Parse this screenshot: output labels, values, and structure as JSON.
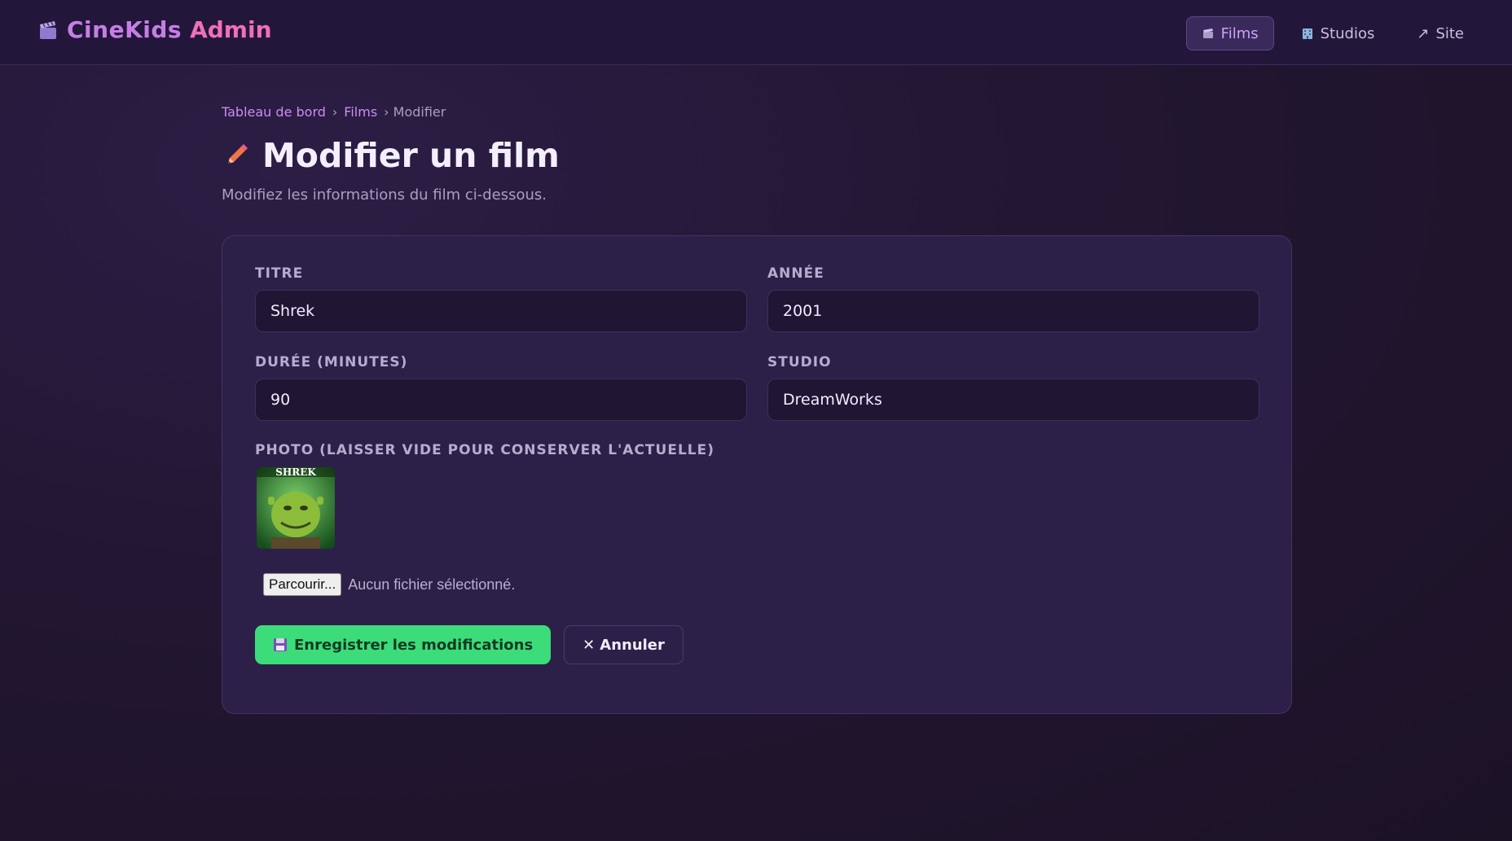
{
  "brand": {
    "name": "CineKids",
    "admin": "Admin"
  },
  "nav": [
    {
      "label": "Films",
      "icon": "film-icon",
      "active": true
    },
    {
      "label": "Studios",
      "icon": "building-icon",
      "active": false
    },
    {
      "label": "Site",
      "icon": "external-arrow-icon",
      "active": false
    }
  ],
  "breadcrumb": {
    "home": "Tableau de bord",
    "sep": "›",
    "films": "Films",
    "current": "› Modifier"
  },
  "page": {
    "title": "Modifier un film",
    "subtitle": "Modifiez les informations du film ci-dessous."
  },
  "form": {
    "titre": {
      "label": "TITRE",
      "value": "Shrek"
    },
    "annee": {
      "label": "ANNÉE",
      "value": "2001"
    },
    "duree": {
      "label": "DURÉE (MINUTES)",
      "value": "90"
    },
    "studio": {
      "label": "STUDIO",
      "value": "DreamWorks"
    },
    "photo": {
      "label": "PHOTO (LAISSER VIDE POUR CONSERVER L'ACTUELLE)",
      "thumb_text": "SHREK"
    },
    "file": {
      "button": "Parcourir...",
      "status": "Aucun fichier sélectionné."
    }
  },
  "actions": {
    "save": "Enregistrer les modifications",
    "cancel": "Annuler"
  },
  "colors": {
    "accent": "#3ddc7a",
    "brand": "#c77de6",
    "brand_admin": "#f06fb8",
    "background": "#221632"
  }
}
